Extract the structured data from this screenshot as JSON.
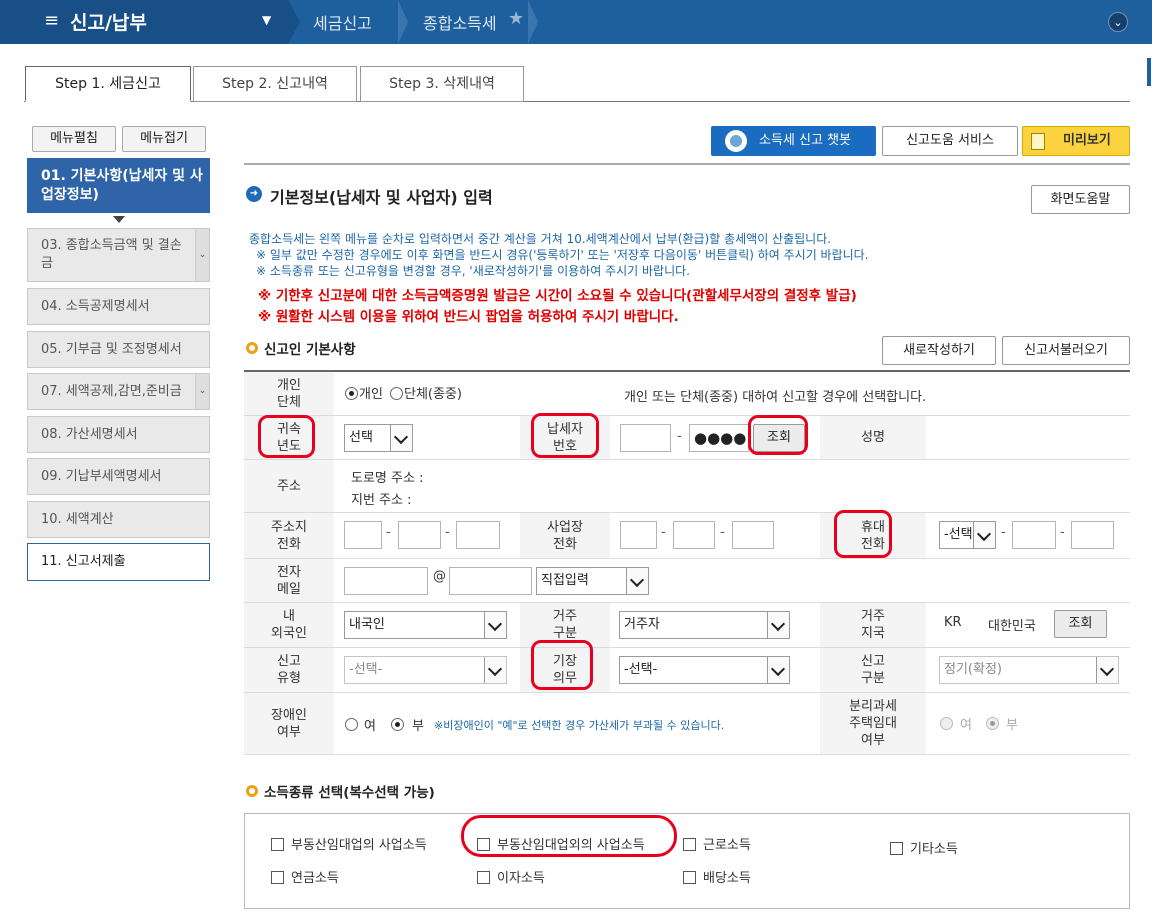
{
  "topbar": {
    "menu_title": "신고/납부",
    "breadcrumb": [
      "세금신고",
      "종합소득세"
    ],
    "hamburger_glyph": "≡",
    "dropdown_glyph": "▼",
    "circle_glyph": "⌄",
    "star_glyph": "★"
  },
  "tabs": [
    "Step 1. 세금신고",
    "Step 2. 신고내역",
    "Step 3. 삭제내역"
  ],
  "left_menu": {
    "expand_label": "메뉴펼침",
    "collapse_label": "메뉴접기",
    "items": [
      "01. 기본사항(납세자 및 사업장정보)",
      "03. 종합소득금액 및 결손금",
      "04. 소득공제명세서",
      "05. 기부금 및 조정명세서",
      "07. 세액공제,감면,준비금",
      "08. 가산세명세서",
      "09. 기납부세액명세서",
      "10. 세액계산",
      "11. 신고서제출"
    ]
  },
  "actions": {
    "chatbot_label": "소득세 신고 챗봇",
    "help_service_label": "신고도움 서비스",
    "preview_label": "미리보기",
    "screen_help_label": "화면도움말"
  },
  "section_title": "기본정보(납세자 및 사업자) 입력",
  "info_lines": [
    "종합소득세는 왼쪽 메뉴를 순차로 입력하면서 중간 계산을 거쳐 10.세액계산에서 납부(환급)할 총세액이 산출됩니다.",
    "※ 일부 값만 수정한 경우에도 이후 화면을 반드시 경유('등록하기' 또는 '저장후 다음이동' 버튼클릭) 하여 주시기 바랍니다.",
    "※ 소득종류 또는 신고유형을 변경할 경우, '새로작성하기'를 이용하여 주시기 바랍니다."
  ],
  "warnings": [
    "※ 기한후 신고분에 대한 소득금액증명원 발급은 시간이 소요될 수 있습니다(관할세무서장의 결정후 발급)",
    "※ 원활한 시스템 이용을 위하여 반드시 팝업을 허용하여 주시기 바랍니다."
  ],
  "reporter_section": {
    "title": "신고인 기본사항",
    "new_button": "새로작성하기",
    "load_button": "신고서불러오기"
  },
  "form": {
    "individual_label": "개인\n단체",
    "opt_individual": "개인",
    "opt_group": "단체(종중)",
    "individual_note": "개인 또는 단체(종중) 대하여 신고할 경우에 선택합니다.",
    "year_label": "귀속\n년도",
    "year_value": "선택",
    "taxpayer_no_label": "납세자\n번호",
    "masked": "●●●●",
    "lookup_label": "조회",
    "name_label": "성명",
    "address_label": "주소",
    "road_address": "도로명 주소 :",
    "lot_address": "지번 주소 :",
    "home_phone_label": "주소지\n전화",
    "biz_phone_label": "사업장\n전화",
    "mobile_label": "휴대\n전화",
    "mobile_select": "-선택",
    "email_label": "전자\n메일",
    "email_at": "@",
    "email_domain_select": "직접입력",
    "nationality_label": "내\n외국인",
    "nationality_value": "내국인",
    "residence_label": "거주\n구분",
    "residence_value": "거주자",
    "residence_country_label": "거주\n지국",
    "country_code": "KR",
    "country_name": "대한민국",
    "report_type_label": "신고\n유형",
    "report_type_value": "-선택-",
    "bookkeeping_label": "기장\n의무",
    "bookkeeping_value": "-선택-",
    "report_div_label": "신고\n구분",
    "report_div_value": "정기(확정)",
    "disabled_label": "장애인\n여부",
    "yes": "여",
    "no": "부",
    "disabled_note": "※비장애인이 \"예\"로 선택한 경우 가산세가 부과될 수 있습니다.",
    "separate_tax_label": "분리과세\n주택임대\n여부"
  },
  "income_section": {
    "title": "소득종류 선택(복수선택 가능)",
    "items": [
      "부동산임대업의 사업소득",
      "부동산임대업외의 사업소득",
      "근로소득",
      "기타소득",
      "연금소득",
      "이자소득",
      "배당소득"
    ]
  },
  "colors": {
    "topbar": "#1e5f9e",
    "accent": "#2f64a8",
    "warning": "#e00000",
    "highlight": "#e8001e",
    "preview": "#fad33e"
  }
}
